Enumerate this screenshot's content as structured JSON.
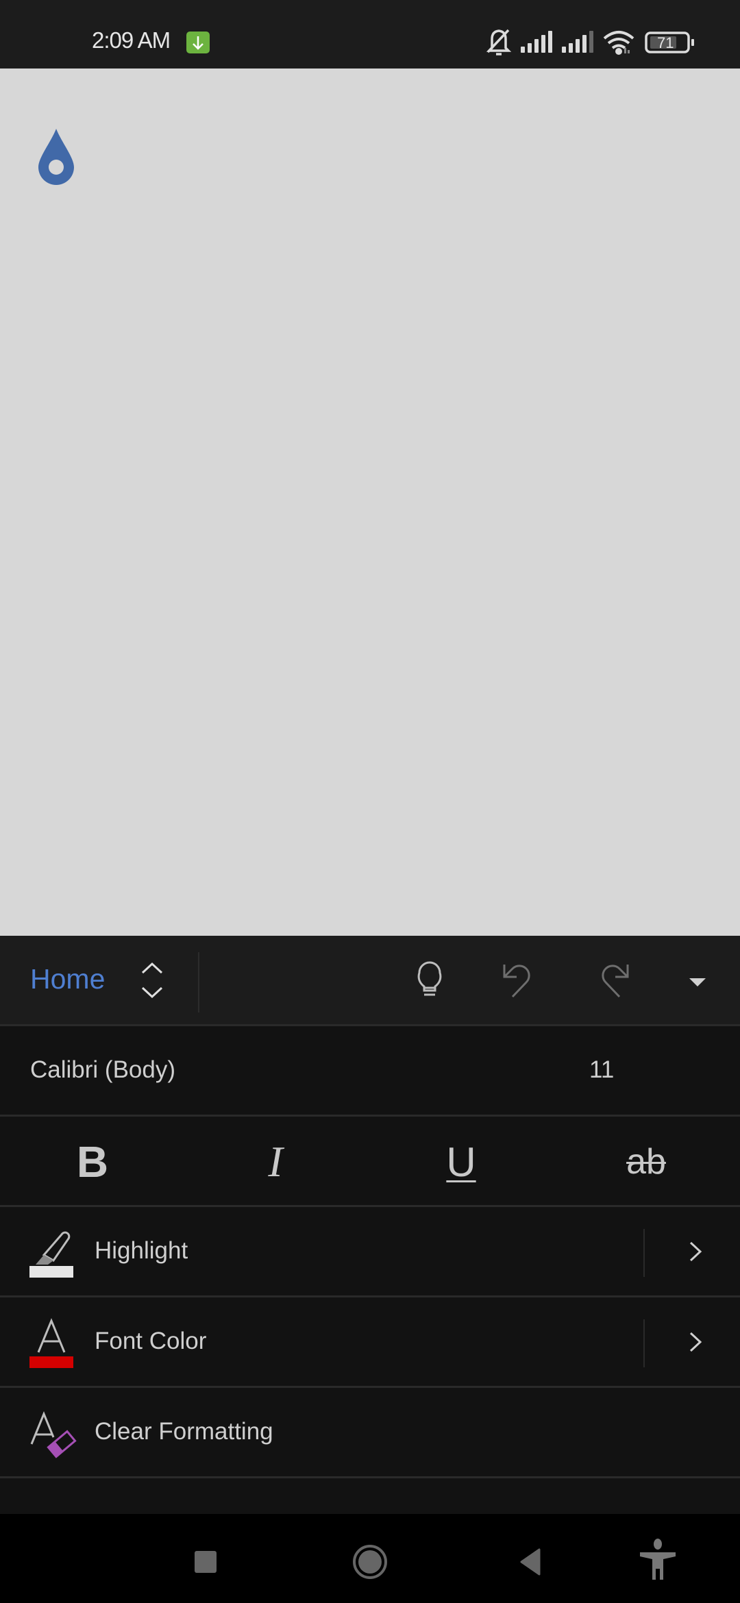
{
  "status_bar": {
    "time": "2:09 AM",
    "notification_icon": "download-icon",
    "battery_level": "71",
    "icons": [
      "mute-bell-icon",
      "signal-icon-sim1",
      "signal-icon-sim2",
      "wifi-icon",
      "battery-icon"
    ]
  },
  "document": {
    "cursor_icon": "drop-cursor-handle-icon"
  },
  "ribbon": {
    "active_tab": "Home",
    "toolbar_icons": [
      "lightbulb-icon",
      "undo-icon",
      "redo-icon",
      "collapse-dropdown-icon"
    ],
    "font": {
      "name": "Calibri (Body)",
      "size": "11"
    },
    "format_buttons": {
      "bold": "B",
      "italic": "I",
      "underline": "U",
      "strikethrough": "ab"
    },
    "items": [
      {
        "label": "Highlight",
        "icon": "highlighter-icon",
        "swatch_color": "#e6e6e6",
        "has_submenu": true
      },
      {
        "label": "Font Color",
        "icon": "font-color-icon",
        "swatch_color": "#d40000",
        "has_submenu": true
      },
      {
        "label": "Clear Formatting",
        "icon": "clear-formatting-icon",
        "has_submenu": false
      }
    ],
    "accent_color": "#4f7fd1"
  },
  "nav_bar": {
    "buttons": [
      "recents-button",
      "home-button",
      "back-button",
      "accessibility-button"
    ]
  }
}
